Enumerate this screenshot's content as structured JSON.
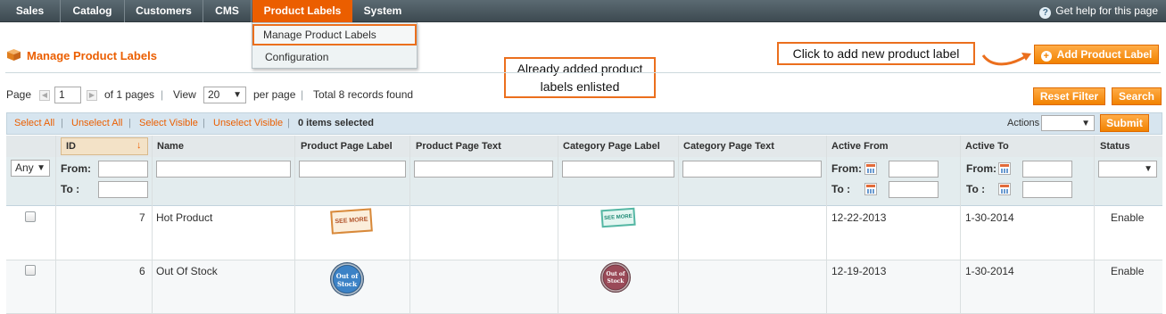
{
  "nav": {
    "items": [
      "Sales",
      "Catalog",
      "Customers",
      "CMS",
      "Product Labels",
      "System"
    ],
    "active": "Product Labels",
    "help_text": "Get help for this page",
    "help_icon": "question-circle-icon"
  },
  "dropdown": {
    "items": [
      "Manage Product Labels",
      "Configuration"
    ],
    "highlighted": "Manage Product Labels"
  },
  "page": {
    "title": "Manage Product Labels",
    "title_icon": "box-icon",
    "add_button": "Add Product Label",
    "add_icon": "plus-circle-icon"
  },
  "callouts": {
    "add": "Click to add new product label",
    "list": "Already added product labels enlisted"
  },
  "pager": {
    "page_label": "Page",
    "page_value": "1",
    "of_pages": "of 1 pages",
    "view_label": "View",
    "view_value": "20",
    "per_page": "per page",
    "separator": "|",
    "total": "Total 8 records found",
    "reset_filter": "Reset Filter",
    "search": "Search"
  },
  "massaction": {
    "select_all": "Select All",
    "unselect_all": "Unselect All",
    "select_visible": "Select Visible",
    "unselect_visible": "Unselect Visible",
    "sep": "|",
    "selected": "0 items selected",
    "actions_label": "Actions",
    "submit": "Submit"
  },
  "grid": {
    "columns": [
      "ID",
      "Name",
      "Product Page Label",
      "Product Page Text",
      "Category Page Label",
      "Category Page Text",
      "Active From",
      "Active To",
      "Status"
    ],
    "filter": {
      "any": "Any",
      "from": "From:",
      "to": "To :"
    },
    "rows": [
      {
        "id": "7",
        "name": "Hot Product",
        "product_label": "SEE MORE",
        "category_label": "SEE MORE",
        "active_from": "12-22-2013",
        "active_to": "1-30-2014",
        "status": "Enable"
      },
      {
        "id": "6",
        "name": "Out Of Stock",
        "product_label": "Out of Stock",
        "category_label": "Out of Stock",
        "active_from": "12-19-2013",
        "active_to": "1-30-2014",
        "status": "Enable"
      }
    ]
  },
  "colors": {
    "accent": "#eb5e00",
    "nav_bg": "#4a575e",
    "callout_border": "#eb6f1d",
    "massbar_bg": "#d7e5ef"
  }
}
